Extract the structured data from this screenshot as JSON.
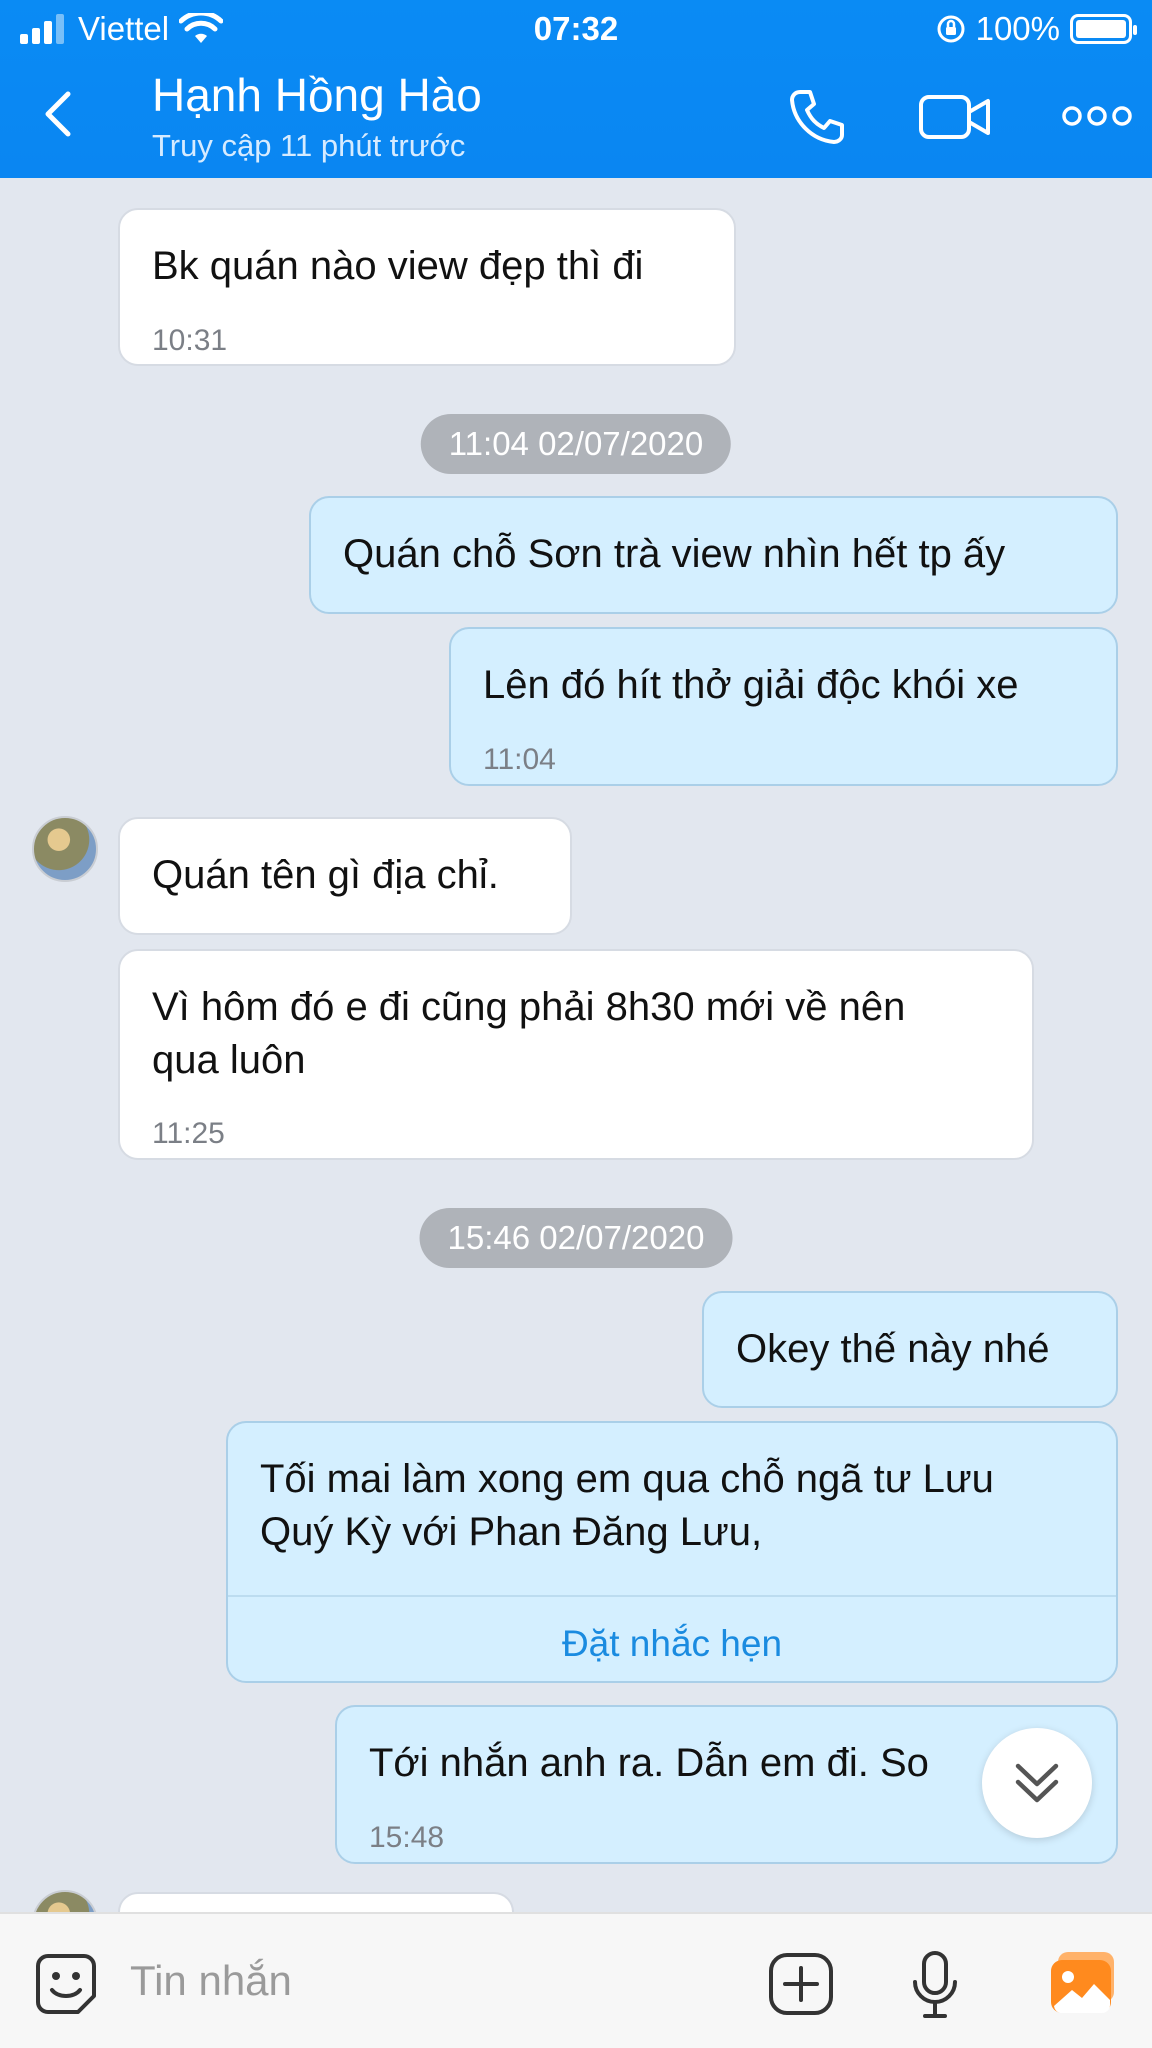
{
  "status_bar": {
    "carrier": "Viettel",
    "time": "07:32",
    "battery": "100%"
  },
  "header": {
    "contact_name": "Hạnh Hồng Hào",
    "contact_status": "Truy cập 11 phút trước"
  },
  "messages": {
    "m1": {
      "text": "Bk quán nào view đẹp thì đi",
      "time": "10:31"
    },
    "sep1": "11:04 02/07/2020",
    "m2": {
      "text": "Quán chỗ Sơn trà view nhìn hết tp ấy"
    },
    "m3": {
      "text": "Lên đó hít thở giải độc khói xe",
      "time": "11:04"
    },
    "m4": {
      "text": "Quán tên gì địa chỉ."
    },
    "m5": {
      "text": "Vì hôm đó e đi cũng phải 8h30 mới về nên\nqua luôn",
      "time": "11:25"
    },
    "sep2": "15:46 02/07/2020",
    "m6": {
      "text": "Okey thế này nhé"
    },
    "m7": {
      "text": "Tối mai làm xong em qua chỗ ngã tư Lưu\nQuý Kỳ với Phan Đăng Lưu,",
      "action": "Đặt nhắc hẹn"
    },
    "m8": {
      "text": "Tới nhắn anh ra. Dẫn em đi. So",
      "time": "15:48"
    }
  },
  "composer": {
    "placeholder": "Tin nhắn"
  },
  "colors": {
    "header_blue": "#0a88f3",
    "outgoing_bubble": "#d4efff",
    "incoming_bubble": "#ffffff",
    "chat_background": "#e2e7ef",
    "link_blue": "#1a8be0"
  },
  "icons": [
    "signal-icon",
    "wifi-icon",
    "rotation-lock-icon",
    "battery-icon",
    "back-chevron-icon",
    "phone-icon",
    "video-camera-icon",
    "more-dots-icon",
    "chevron-double-down-icon",
    "sticker-icon",
    "plus-icon",
    "microphone-icon",
    "image-gallery-icon"
  ]
}
